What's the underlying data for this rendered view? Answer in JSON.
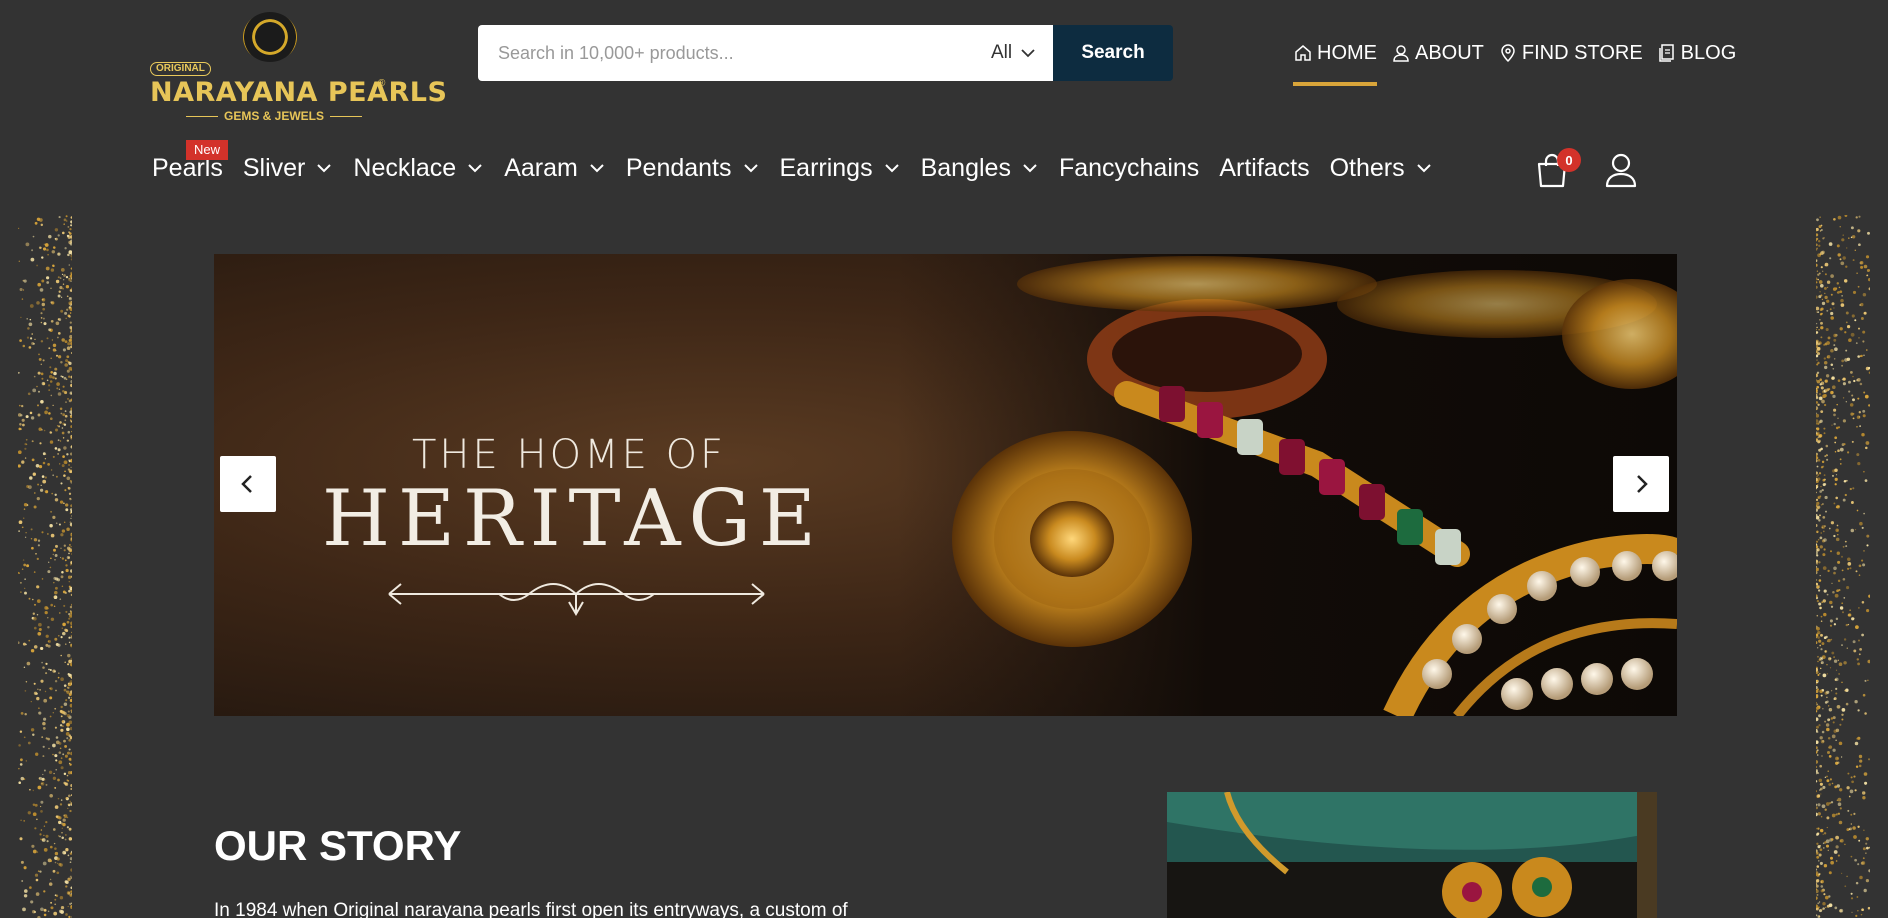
{
  "brand": {
    "badge": "ORIGINAL",
    "name": "NARAYANA PEARLS",
    "registered": "®",
    "tagline": "GEMS & JEWELS"
  },
  "search": {
    "placeholder": "Search in 10,000+ products...",
    "category": "All",
    "button": "Search"
  },
  "top_links": [
    {
      "label": "HOME",
      "icon": "home-icon",
      "active": true
    },
    {
      "label": "ABOUT",
      "icon": "user-icon",
      "active": false
    },
    {
      "label": "FIND  STORE",
      "icon": "location-pin-icon",
      "active": false
    },
    {
      "label": "BLOG",
      "icon": "document-icon",
      "active": false
    }
  ],
  "nav": {
    "items": [
      {
        "label": "Pearls",
        "badge": "New",
        "dropdown": false
      },
      {
        "label": "Sliver",
        "dropdown": true
      },
      {
        "label": "Necklace",
        "dropdown": true
      },
      {
        "label": "Aaram",
        "dropdown": true
      },
      {
        "label": "Pendants",
        "dropdown": true
      },
      {
        "label": "Earrings",
        "dropdown": true
      },
      {
        "label": "Bangles",
        "dropdown": true
      },
      {
        "label": "Fancychains",
        "dropdown": false
      },
      {
        "label": "Artifacts",
        "dropdown": false
      },
      {
        "label": "Others",
        "dropdown": true
      }
    ],
    "cart_count": "0"
  },
  "hero": {
    "line1": "THE HOME OF",
    "line2": "HERITAGE"
  },
  "story": {
    "title": "OUR STORY",
    "text": "In 1984 when Original narayana pearls first open its entryways, a custom of"
  },
  "colors": {
    "background": "#333333",
    "accent": "#d9a53a",
    "search_button": "#0d2c40",
    "badge": "#d3322a",
    "brand_gold": "#e7c558"
  }
}
